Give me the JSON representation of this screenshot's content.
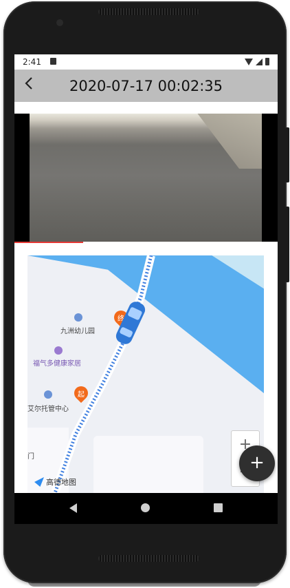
{
  "status_bar": {
    "time": "2:41"
  },
  "header": {
    "title": "2020-07-17 00:02:35",
    "back_icon": "chevron-left-icon"
  },
  "video": {
    "progress_percent": 26
  },
  "map": {
    "pois": [
      {
        "name": "九洲幼儿园"
      },
      {
        "name": "福气多健康家居"
      },
      {
        "name": "艾尔托管中心"
      },
      {
        "name": "门"
      }
    ],
    "pin_start_letter": "终",
    "pin_end_letter": "起",
    "logo": "高德地图",
    "zoom_in": "+",
    "zoom_out": "−",
    "colors": {
      "water": "#5aaff0",
      "route": "#3f7fe0",
      "pin": "#f26a1b"
    }
  },
  "fab": {
    "label": "+"
  }
}
